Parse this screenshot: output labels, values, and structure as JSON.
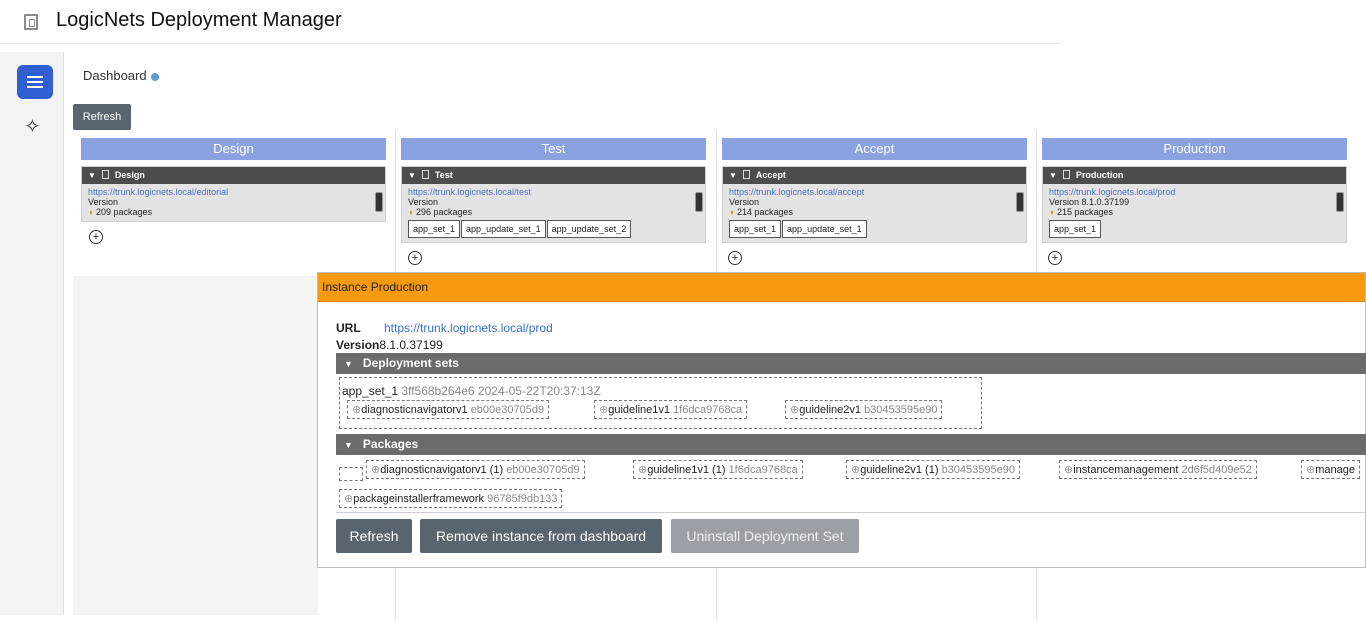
{
  "app": {
    "title": "LogicNets Deployment Manager"
  },
  "sidebar": {
    "menu_icon": "hamburger-icon",
    "assist_icon": "sparkle-icon"
  },
  "dashboard": {
    "title": "Dashboard",
    "refresh_label": "Refresh"
  },
  "stages": [
    {
      "header": "Design",
      "card_title": "Design",
      "url": "https://trunk.logicnets.local/editorial",
      "version_label": "Version",
      "version": "",
      "packages": "209 packages",
      "sets": []
    },
    {
      "header": "Test",
      "card_title": "Test",
      "url": "https://trunk.logicnets.local/test",
      "version_label": "Version",
      "version": "",
      "packages": "296 packages",
      "sets": [
        "app_set_1",
        "app_update_set_1",
        "app_update_set_2"
      ]
    },
    {
      "header": "Accept",
      "card_title": "Accept",
      "url": "https://trunk.logicnets.local/accept",
      "version_label": "Version",
      "version": "",
      "packages": "214 packages",
      "sets": [
        "app_set_1",
        "app_update_set_1"
      ]
    },
    {
      "header": "Production",
      "card_title": "Production",
      "url": "https://trunk.logicnets.local/prod",
      "version_label": "Version",
      "version": "8.1.0.37199",
      "packages": "215 packages",
      "sets": [
        "app_set_1"
      ]
    }
  ],
  "instance": {
    "title": "Instance Production",
    "url_label": "URL",
    "url": "https://trunk.logicnets.local/prod",
    "version_label": "Version",
    "version": "8.1.0.37199",
    "deployment_sets_label": "Deployment sets",
    "set_name": "app_set_1",
    "set_meta": "3ff568b264e6 2024-05-22T20:37:13Z",
    "set_packages": [
      {
        "name": "diagnosticnavigatorv1",
        "hash": "eb00e30705d9"
      },
      {
        "name": "guideline1v1",
        "hash": "1f6dca9768ca"
      },
      {
        "name": "guideline2v1",
        "hash": "b30453595e90"
      }
    ],
    "packages_label": "Packages",
    "packages": [
      {
        "name": "diagnosticnavigatorv1 (1)",
        "hash": "eb00e30705d9"
      },
      {
        "name": "guideline1v1 (1)",
        "hash": "1f6dca9768ca"
      },
      {
        "name": "guideline2v1 (1)",
        "hash": "b30453595e90"
      },
      {
        "name": "instancemanagement",
        "hash": "2d6f5d409e52"
      },
      {
        "name": "manage",
        "hash": ""
      },
      {
        "name": "packageinstallerframework",
        "hash": "96785f9db133"
      }
    ],
    "buttons": {
      "refresh": "Refresh",
      "remove": "Remove instance from dashboard",
      "uninstall": "Uninstall Deployment Set"
    }
  }
}
